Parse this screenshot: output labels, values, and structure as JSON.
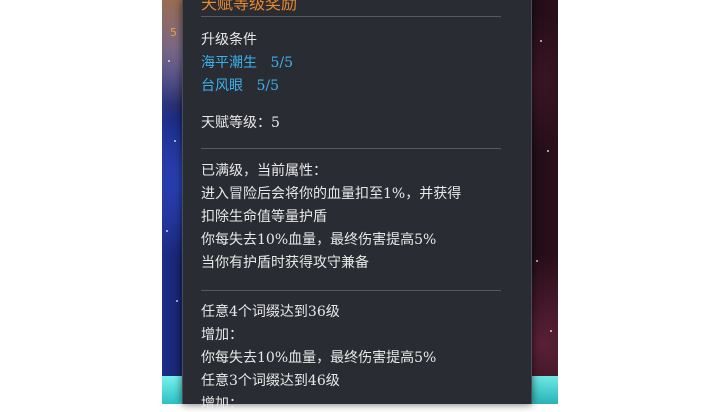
{
  "tooltip": {
    "header_partial": "天赋等级奖励",
    "upgrade": {
      "title": "升级条件",
      "conditions": [
        {
          "label": "海平潮生",
          "progress": "5/5"
        },
        {
          "label": "台风眼",
          "progress": "5/5"
        }
      ]
    },
    "talent_level": "天赋等级：5",
    "maxed": {
      "title": "已满级，当前属性：",
      "lines": [
        "进入冒险后会将你的血量扣至1%，并获得",
        "扣除生命值等量护盾",
        "你每失去10%血量，最终伤害提高5%",
        "当你有护盾时获得攻守兼备"
      ]
    },
    "bonus": {
      "lines": [
        "任意4个词缀达到36级",
        "增加：",
        "你每失去10%血量，最终伤害提高5%",
        "任意3个词缀达到46级",
        "增加："
      ]
    }
  },
  "background": {
    "edge_glyph": "5",
    "colors": {
      "panel": "#2a2c33",
      "highlight_blue": "#3ab2ec",
      "header_orange": "#e6882f",
      "button_cyan": "#3fd0d2"
    }
  }
}
